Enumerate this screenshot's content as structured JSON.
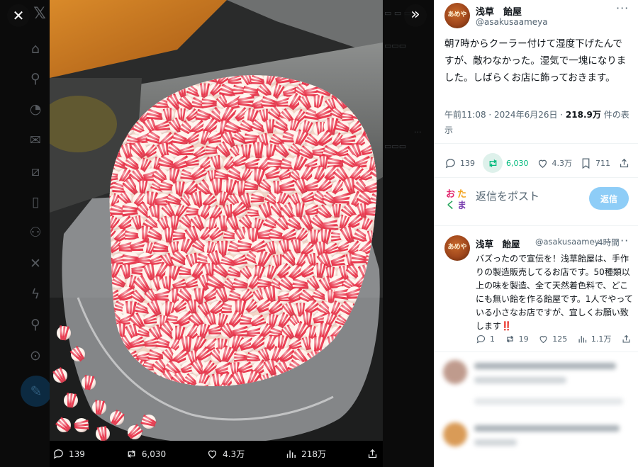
{
  "viewer": {
    "close_icon": "close-icon",
    "expand_icon": "chevrons-right-icon",
    "media_actions": {
      "replies": "139",
      "reposts": "6,030",
      "likes": "4.3万",
      "views": "218万"
    }
  },
  "tweet": {
    "author_name": "浅草　飴屋",
    "author_handle": "@asakusaameya",
    "text": "朝7時からクーラー付けて湿度下げたんですが、敵わなかった。湿気で一塊になりました。しばらくお店に飾っておきます。",
    "timestamp": "午前11:08 · 2024年6月26日 · ",
    "view_count": "218.9万",
    "view_suffix": " 件の表示",
    "actions": {
      "replies": "139",
      "reposts": "6,030",
      "likes": "4.3万",
      "bookmarks": "711"
    }
  },
  "reply_composer": {
    "placeholder": "返信をポスト",
    "button_label": "返信",
    "logo_chars": [
      "お",
      "た",
      "く",
      "ま"
    ]
  },
  "reply": {
    "author_name": "浅草　飴屋",
    "author_handle": "@asakusaamey",
    "time": "· 4時間",
    "text": "バズったので宣伝を！浅草飴屋は、手作りの製造販売してるお店です。50種類以上の味を製造、全て天然着色料で、どこにも無い飴を作る飴屋です。1人でやっている小さなお店ですが、宜しくお願い致します",
    "emphasis": "‼️",
    "actions": {
      "replies": "1",
      "reposts": "19",
      "likes": "125",
      "views": "1.1万"
    }
  },
  "colors": {
    "accent": "#1d9bf0",
    "repost_green": "#00ba7c",
    "reply_button": "#8ecdf7",
    "candy_red": "#e8344a",
    "candy_white": "#fff4ec"
  }
}
